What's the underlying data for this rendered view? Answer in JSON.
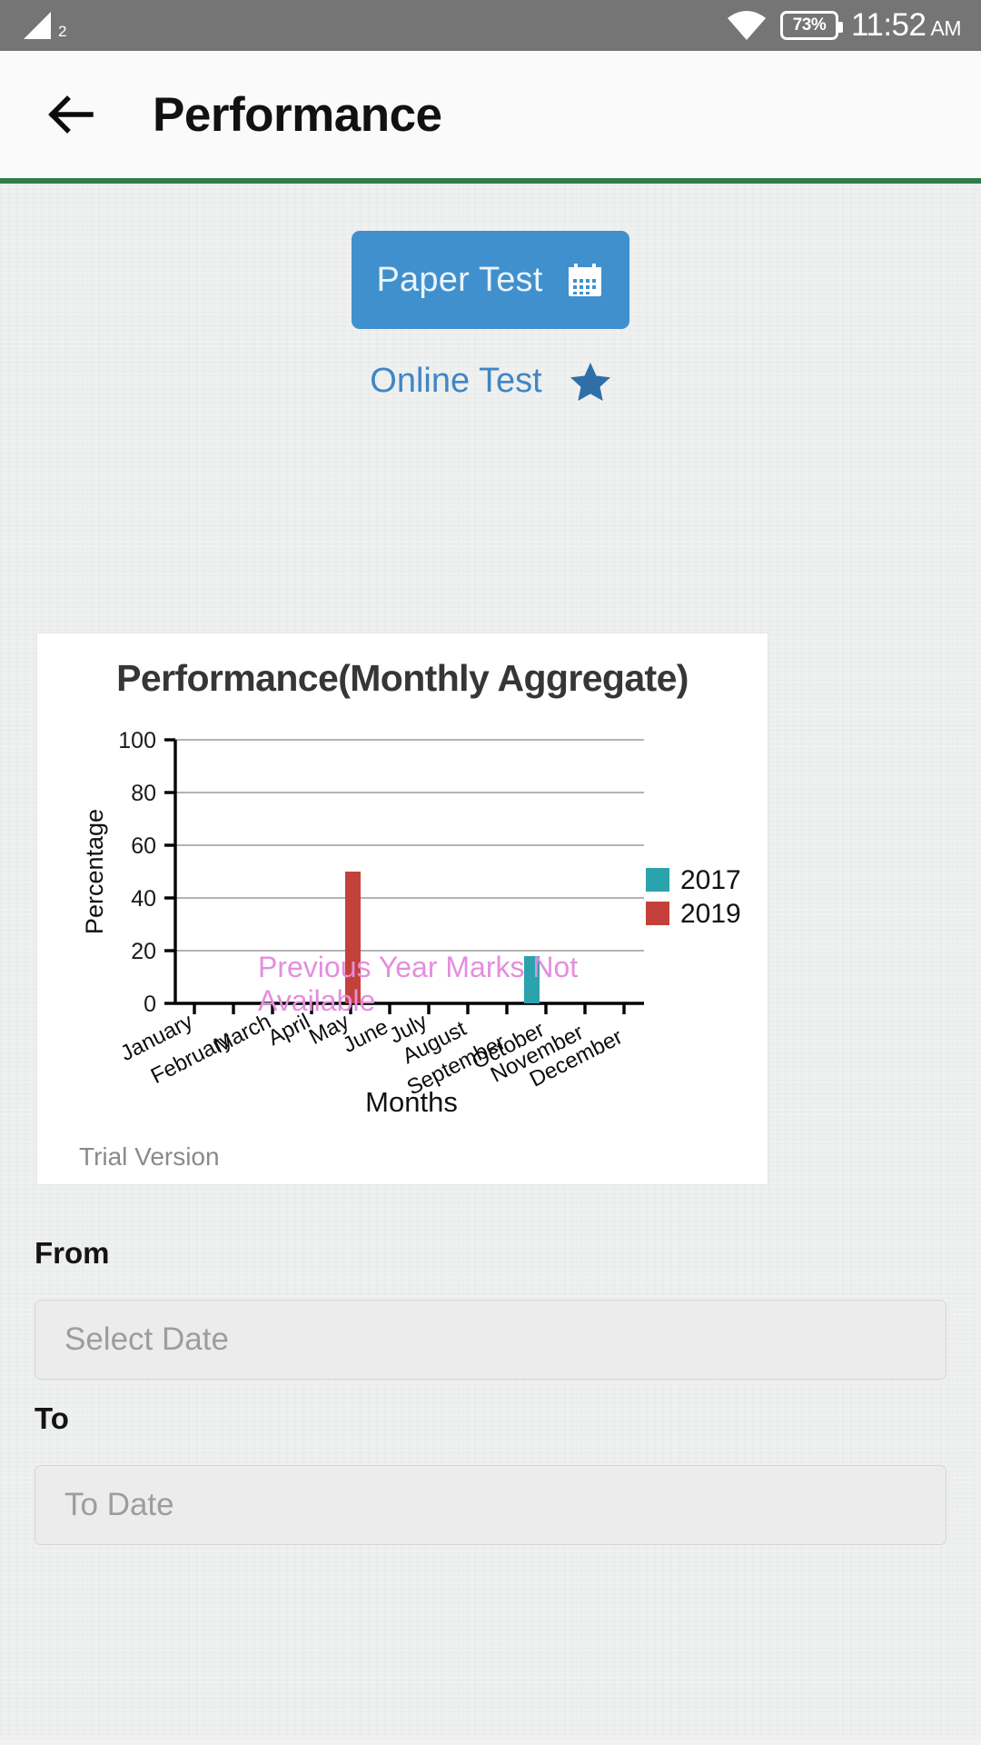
{
  "status_bar": {
    "signal_label": "2",
    "battery_percent": "73%",
    "time": "11:52",
    "time_ampm": "AM",
    "icons": [
      "signal-icon",
      "wifi-icon",
      "battery-icon"
    ]
  },
  "app_bar": {
    "back_icon": "back-arrow-icon",
    "title": "Performance",
    "accent_color": "#2e7d46"
  },
  "tabs": [
    {
      "label": "Paper Test",
      "icon": "calendar-icon",
      "selected": true,
      "bg": "#4090cd",
      "fg": "#eaf4fb"
    },
    {
      "label": "Online Test",
      "icon": "star-icon",
      "selected": false,
      "fg": "#3f86c4"
    }
  ],
  "card": {
    "watermark": "Trial Version"
  },
  "chart_data": {
    "type": "bar",
    "title": "Performance(Monthly Aggregate)",
    "xlabel": "Months",
    "ylabel": "Percentage",
    "ylim": [
      0,
      100
    ],
    "yticks": [
      0,
      20,
      40,
      60,
      80,
      100
    ],
    "grid": true,
    "legend_position": "right",
    "categories": [
      "January",
      "February",
      "March",
      "April",
      "May",
      "June",
      "July",
      "August",
      "September",
      "October",
      "November",
      "December"
    ],
    "series": [
      {
        "name": "2017",
        "color": "#2ba3ad",
        "values": [
          0,
          0,
          0,
          0,
          0,
          0,
          0,
          0,
          0,
          18,
          0,
          0
        ]
      },
      {
        "name": "2019",
        "color": "#c3413a",
        "values": [
          0,
          0,
          0,
          0,
          50,
          0,
          0,
          0,
          0,
          0,
          0,
          0
        ]
      }
    ],
    "annotation": {
      "text": "Previous Year Marks Not Available",
      "color": "#e48ede"
    }
  },
  "form": {
    "from": {
      "label": "From",
      "placeholder": "Select Date",
      "value": ""
    },
    "to": {
      "label": "To",
      "placeholder": "To Date",
      "value": ""
    }
  }
}
